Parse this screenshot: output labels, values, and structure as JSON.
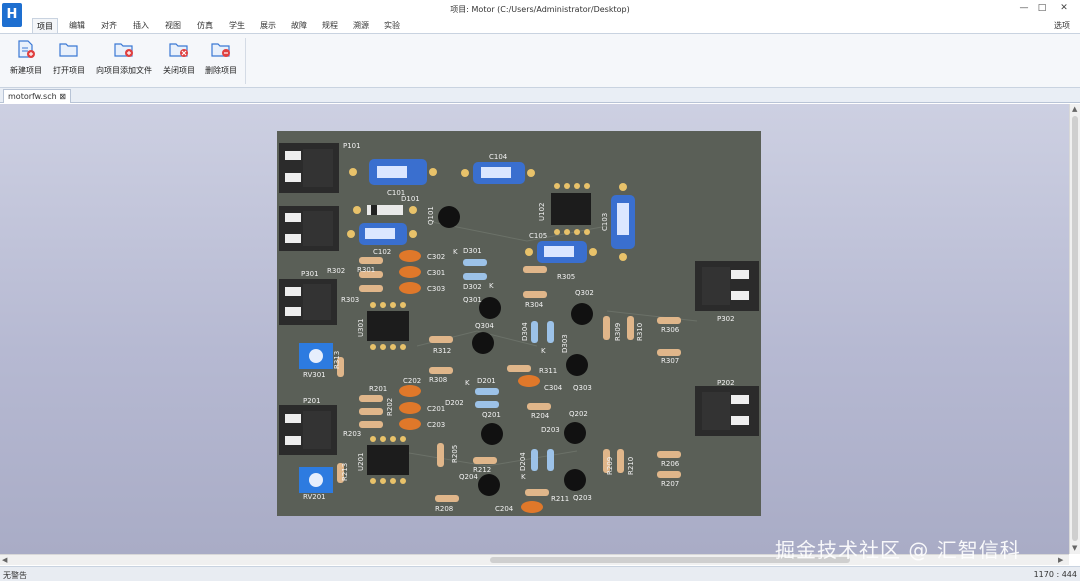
{
  "app": {
    "logo_text": "H",
    "title": "项目: Motor (C:/Users/Administrator/Desktop)"
  },
  "window_controls": {
    "minimize": "—",
    "maximize": "□",
    "close": "✕"
  },
  "menu": {
    "tabs": [
      "项目",
      "编辑",
      "对齐",
      "插入",
      "视图",
      "仿真",
      "学生",
      "展示",
      "故障",
      "规程",
      "溯源",
      "实验"
    ],
    "active_index": 0,
    "options_label": "选项"
  },
  "ribbon": {
    "buttons": [
      {
        "label": "新建项目",
        "icon": "new-project-icon"
      },
      {
        "label": "打开项目",
        "icon": "open-project-icon"
      },
      {
        "label": "向项目添加文件",
        "icon": "add-file-icon"
      },
      {
        "label": "关闭项目",
        "icon": "close-project-icon"
      },
      {
        "label": "删除项目",
        "icon": "delete-project-icon"
      }
    ]
  },
  "document_tab": {
    "label": "motorfw.sch ⊠"
  },
  "board_labels": {
    "connectors": [
      "P101",
      "P301",
      "P201",
      "P302",
      "P202"
    ],
    "capacitors": [
      "C101",
      "C104",
      "C102",
      "C105",
      "C103",
      "C302",
      "C301",
      "C303",
      "C202",
      "C201",
      "C203",
      "C304",
      "C204"
    ],
    "resistors": [
      "R302",
      "R301",
      "R303",
      "R305",
      "R304",
      "R312",
      "R308",
      "R311",
      "R309",
      "R310",
      "R306",
      "R307",
      "R201",
      "R202",
      "R203",
      "R204",
      "R205",
      "R212",
      "R211",
      "R208",
      "R209",
      "R210",
      "R206",
      "R207",
      "R313",
      "R213"
    ],
    "diodes": [
      "D101",
      "D301",
      "D302",
      "D304",
      "D303",
      "D201",
      "D202",
      "D203",
      "D204"
    ],
    "transistors": [
      "Q101",
      "Q301",
      "Q304",
      "Q302",
      "Q303",
      "Q201",
      "Q202",
      "Q204",
      "Q203"
    ],
    "ics": [
      "U102",
      "U301",
      "U201"
    ],
    "trimmers": [
      "RV301",
      "RV201"
    ],
    "pin_marks": [
      "K",
      "K",
      "K",
      "K",
      "K"
    ]
  },
  "watermark": "掘金技术社区 @ 汇智信科",
  "status": {
    "left": "无警告",
    "right": "1170 : 444"
  },
  "colors": {
    "accent": "#1e6fd0",
    "board": "#5a5f57",
    "canvas": "#bcbfd6",
    "pad": "#e8c26a",
    "resistor": "#e0b68a",
    "capacitor_blue": "#3a6fcf",
    "capacitor_orange": "#e0782a",
    "connector": "#2b2b2b"
  }
}
